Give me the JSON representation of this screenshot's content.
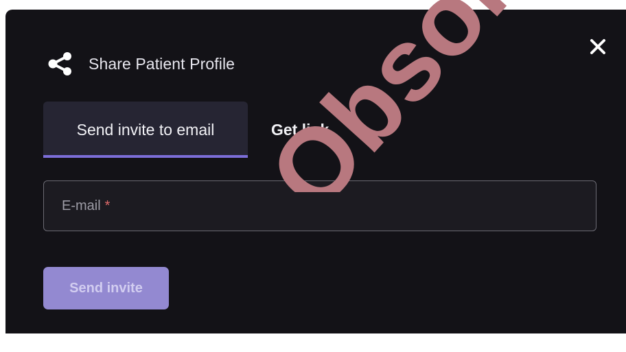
{
  "dialog": {
    "title": "Share Patient Profile",
    "title_icon": "share-icon",
    "close_icon": "close-icon"
  },
  "tabs": [
    {
      "label": "Send invite to email",
      "active": true
    },
    {
      "label": "Get link",
      "active": false
    }
  ],
  "email_field": {
    "label": "E-mail",
    "required_marker": "*"
  },
  "actions": {
    "send_label": "Send invite",
    "disabled": true
  },
  "watermark": {
    "text": "Obsolete",
    "color": "#b8787f"
  },
  "colors": {
    "dialog_background": "#131217",
    "accent": "#7c6ed8",
    "button_background": "#9389d1",
    "required": "#e06a6a"
  }
}
